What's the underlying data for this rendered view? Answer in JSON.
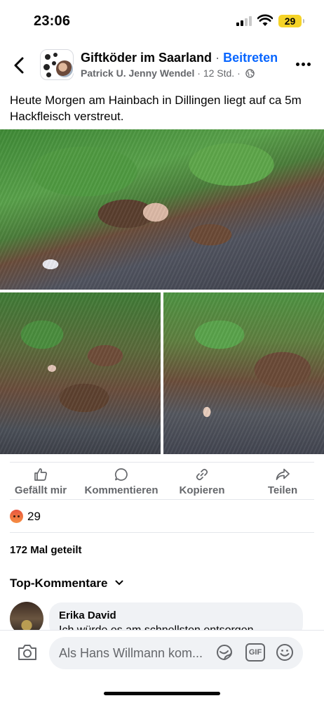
{
  "status_bar": {
    "time": "23:06",
    "battery": "29",
    "battery_color": "#f5d327"
  },
  "header": {
    "back_icon": "chevron-left-icon",
    "group_name": "Giftköder im Saarland",
    "separator": "·",
    "join_label": "Beitreten",
    "author": "Patrick U. Jenny Wendel",
    "time_ago": "12 Std.",
    "privacy_icon": "globe-icon",
    "more_icon": "ellipsis-icon"
  },
  "post": {
    "text": "Heute Morgen am Hainbach in Dillingen liegt auf ca 5m Hackfleisch verstreut."
  },
  "actions": [
    {
      "label": "Gefällt mir",
      "icon": "thumbs-up-icon"
    },
    {
      "label": "Kommentieren",
      "icon": "comment-icon"
    },
    {
      "label": "Kopieren",
      "icon": "link-icon"
    },
    {
      "label": "Teilen",
      "icon": "share-icon"
    }
  ],
  "reactions": {
    "icon": "angry-reaction-icon",
    "count": "29"
  },
  "shares": "172 Mal geteilt",
  "comments_section": {
    "title": "Top-Kommentare",
    "first_comment": {
      "author": "Erika David",
      "text": "Ich würde es  am schnellsten entsorgen..."
    }
  },
  "composer": {
    "placeholder": "Als Hans Willmann kom...",
    "gif_label": "GIF"
  },
  "colors": {
    "accent": "#0866ff",
    "secondary_text": "#65676b",
    "bubble": "#f0f2f5"
  }
}
